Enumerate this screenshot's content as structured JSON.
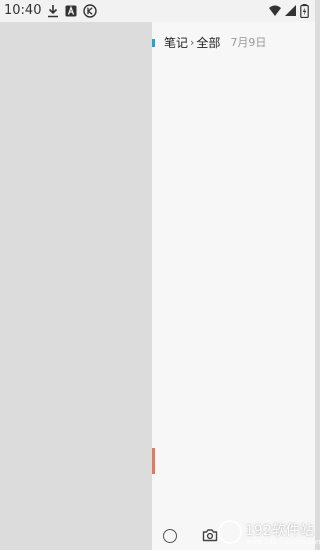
{
  "status_bar": {
    "time": "10:40",
    "left_icons": [
      "download-icon",
      "text-box-icon",
      "k-circle-icon"
    ],
    "right_icons": [
      "wifi-icon",
      "signal-icon",
      "battery-charging-icon"
    ]
  },
  "header": {
    "breadcrumb_root": "笔记",
    "breadcrumb_separator": "›",
    "breadcrumb_current": "全部",
    "date": "7月9日"
  },
  "colors": {
    "accent": "#1aa6d6",
    "marker": "#e07a5f",
    "left_panel": "#dcdcdc",
    "right_panel": "#f7f7f7"
  },
  "toolbar": {
    "icons": [
      "circle-icon",
      "camera-icon"
    ]
  },
  "watermark": {
    "text": "192软件站",
    "url": "www.192ruanjian.com"
  }
}
